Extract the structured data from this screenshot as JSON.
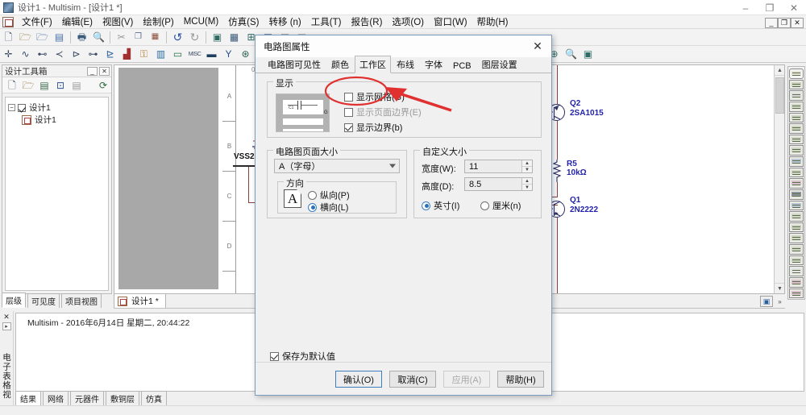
{
  "window": {
    "title": "设计1 - Multisim - [设计1 *]",
    "app_icon": "multisim-icon",
    "controls": {
      "minimize": "–",
      "maximize": "❐",
      "close": "✕"
    },
    "mdi_controls": {
      "minimize": "_",
      "restore": "❐",
      "close": "✕"
    }
  },
  "menubar": {
    "items": [
      "文件(F)",
      "编辑(E)",
      "视图(V)",
      "绘制(P)",
      "MCU(M)",
      "仿真(S)",
      "转移 (n)",
      "工具(T)",
      "报告(R)",
      "选项(O)",
      "窗口(W)",
      "帮助(H)"
    ]
  },
  "toolbar_main": {
    "buttons": [
      "new-file",
      "open-file",
      "open-design",
      "save",
      "print",
      "print-preview",
      "cut",
      "copy",
      "paste",
      "undo",
      "redo",
      "toggle-full-screen",
      "show-grid",
      "show-page-bounds",
      "show-graph",
      "back-annotate",
      "forward-annotate"
    ]
  },
  "toolbar_components": {
    "buttons": [
      "source",
      "basic",
      "diode",
      "transistor",
      "analog",
      "tt-digital",
      "cmos",
      "misc-digital",
      "mixed",
      "indicator",
      "power",
      "misc",
      "advanced-peripherals",
      "rf",
      "electromechanical",
      "nidaqmx",
      "connectors",
      "hierarchical-block",
      "bus"
    ]
  },
  "toolbar_zoom": {
    "buttons": [
      "select",
      "zoom-out",
      "zoom-in",
      "zoom-area",
      "zoom-fit"
    ]
  },
  "design_toolbox": {
    "title": "设计工具箱",
    "header_buttons": [
      "minimize-panel",
      "close-panel"
    ],
    "toolbar_buttons": [
      "new-design",
      "open-design",
      "save-design",
      "new-sheet",
      "delete-sheet",
      "refresh"
    ],
    "tree": {
      "root_label": "设计1",
      "child_label": "设计1"
    },
    "tabs": [
      {
        "label": "层级",
        "active": true
      },
      {
        "label": "可见度",
        "active": false
      },
      {
        "label": "项目视图",
        "active": false
      }
    ]
  },
  "canvas": {
    "ruler_labels": [
      "A",
      "B",
      "C",
      "D"
    ],
    "top_label": "0",
    "components": [
      {
        "ref": "Q2",
        "value": "2SA1015",
        "type": "pnp-transistor"
      },
      {
        "ref": "R5",
        "value": "10kΩ",
        "type": "resistor"
      },
      {
        "ref": "Q1",
        "value": "2N2222",
        "type": "npn-transistor"
      }
    ],
    "net_labels": [
      "VSS2",
      "5"
    ]
  },
  "document_tabs": [
    {
      "label": "设计1 *",
      "active": true
    }
  ],
  "instrument_bar": {
    "items": [
      "multimeter",
      "function-generator",
      "wattmeter",
      "oscilloscope",
      "four-channel-oscilloscope",
      "bode-plotter",
      "frequency-counter",
      "word-generator",
      "logic-converter",
      "logic-analyzer",
      "iv-analyzer",
      "distortion-analyzer",
      "spectrum-analyzer",
      "network-analyzer",
      "agilent-function-generator",
      "agilent-multimeter",
      "agilent-oscilloscope",
      "tektronix-oscilloscope",
      "measurement-probe",
      "labview-instruments",
      "ni-elvismx-instruments",
      "current-probe"
    ]
  },
  "spreadsheet_view": {
    "side_label": "电子表格视图",
    "close_button": "✕",
    "expand_button": "▸",
    "log_line": "Multisim  -  2016年6月14日 星期二, 20:44:22",
    "tabs": [
      {
        "label": "结果",
        "active": true
      },
      {
        "label": "网络",
        "active": false
      },
      {
        "label": "元器件",
        "active": false
      },
      {
        "label": "敷铜层",
        "active": false
      },
      {
        "label": "仿真",
        "active": false
      }
    ]
  },
  "dialog": {
    "title": "电路图属性",
    "close_label": "✕",
    "tabs": [
      {
        "label": "电路图可见性",
        "active": false
      },
      {
        "label": "颜色",
        "active": false
      },
      {
        "label": "工作区",
        "active": true
      },
      {
        "label": "布线",
        "active": false
      },
      {
        "label": "字体",
        "active": false
      },
      {
        "label": "PCB",
        "active": false
      },
      {
        "label": "图层设置",
        "active": false
      }
    ],
    "display_group": {
      "legend": "显示",
      "preview_name": "workspace-preview",
      "checkboxes": [
        {
          "label": "显示网格(G)",
          "checked": false,
          "highlighted": true
        },
        {
          "label": "显示页面边界(E)",
          "checked": false,
          "dim": true
        },
        {
          "label": "显示边界(b)",
          "checked": true
        }
      ]
    },
    "page_size_group": {
      "legend": "电路图页面大小",
      "select_value": "A（字母）",
      "orientation": {
        "legend": "方向",
        "icon": "page-orientation-icon",
        "icon_glyph": "A",
        "options": [
          {
            "label": "纵向(P)",
            "selected": false
          },
          {
            "label": "横向(L)",
            "selected": true
          }
        ]
      }
    },
    "custom_size_group": {
      "legend": "自定义大小",
      "width": {
        "label": "宽度(W):",
        "value": "11"
      },
      "height": {
        "label": "高度(D):",
        "value": "8.5"
      },
      "units": [
        {
          "label": "英寸(I)",
          "selected": true
        },
        {
          "label": "厘米(n)",
          "selected": false
        }
      ]
    },
    "save_default": {
      "label": "保存为默认值",
      "checked": true
    },
    "buttons": [
      {
        "label": "确认(O)",
        "style": "default"
      },
      {
        "label": "取消(C)",
        "style": "normal"
      },
      {
        "label": "应用(A)",
        "style": "disabled"
      },
      {
        "label": "帮助(H)",
        "style": "normal"
      }
    ]
  },
  "annotation": {
    "ellipse_name": "highlight-ellipse-show-grid",
    "arrow_name": "pointer-arrow",
    "color": "#e03030"
  },
  "watermark": {
    "text": ""
  },
  "colors": {
    "dialog_border": "#7a9abf",
    "accent_blue": "#2b72b8",
    "annotation_red": "#e03030",
    "component_label": "#2222aa",
    "selection_gray": "#a8a8a8"
  }
}
